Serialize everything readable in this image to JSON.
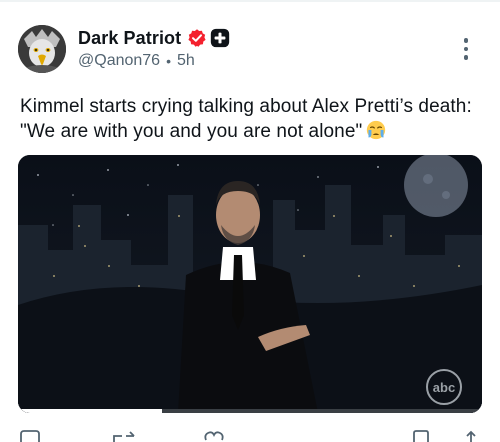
{
  "post": {
    "author_name": "Dark Patriot",
    "handle": "@Qanon76",
    "separator": "•",
    "time": "5h",
    "text_line1": "Kimmel starts crying talking about Alex Pretti’s death:",
    "text_line2": "\"We are with you and you are not alone\""
  },
  "media": {
    "network_logo": "abc",
    "progress_fraction": 0.31
  },
  "icons": {
    "verified": "verified-badge-icon",
    "subscriber": "plus-badge-icon",
    "more": "more-vertical-icon",
    "emoji": "crying-face-emoji"
  },
  "colors": {
    "verified": "#f4212e",
    "text": "#0f1419",
    "muted": "#536471"
  }
}
